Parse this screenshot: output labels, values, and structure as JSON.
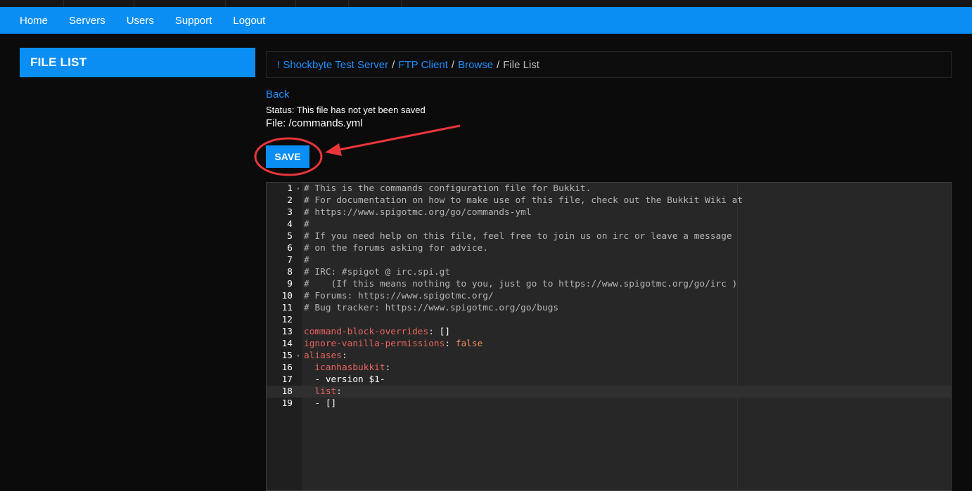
{
  "nav": {
    "items": [
      "Home",
      "Servers",
      "Users",
      "Support",
      "Logout"
    ]
  },
  "sidebar": {
    "title": "FILE LIST"
  },
  "breadcrumb": {
    "items": [
      "! Shockbyte Test Server",
      "FTP Client",
      "Browse"
    ],
    "current": "File List",
    "separator": "/"
  },
  "file_info": {
    "back_label": "Back",
    "status": "Status: This file has not yet been saved",
    "file": "File: /commands.yml"
  },
  "toolbar": {
    "save_label": "SAVE"
  },
  "editor": {
    "active_line": 18,
    "foldable_lines": [
      1,
      15
    ],
    "lines": [
      [
        {
          "t": "comment",
          "v": "# This is the commands configuration file for Bukkit."
        }
      ],
      [
        {
          "t": "comment",
          "v": "# For documentation on how to make use of this file, check out the Bukkit Wiki at"
        }
      ],
      [
        {
          "t": "comment",
          "v": "# https://www.spigotmc.org/go/commands-yml"
        }
      ],
      [
        {
          "t": "comment",
          "v": "#"
        }
      ],
      [
        {
          "t": "comment",
          "v": "# If you need help on this file, feel free to join us on irc or leave a message"
        }
      ],
      [
        {
          "t": "comment",
          "v": "# on the forums asking for advice."
        }
      ],
      [
        {
          "t": "comment",
          "v": "#"
        }
      ],
      [
        {
          "t": "comment",
          "v": "# IRC: #spigot @ irc.spi.gt"
        }
      ],
      [
        {
          "t": "comment",
          "v": "#    (If this means nothing to you, just go to https://www.spigotmc.org/go/irc )"
        }
      ],
      [
        {
          "t": "comment",
          "v": "# Forums: https://www.spigotmc.org/"
        }
      ],
      [
        {
          "t": "comment",
          "v": "# Bug tracker: https://www.spigotmc.org/go/bugs"
        }
      ],
      [],
      [
        {
          "t": "key",
          "v": "command-block-overrides"
        },
        {
          "t": "punct",
          "v": ": "
        },
        {
          "t": "text",
          "v": "[]"
        }
      ],
      [
        {
          "t": "key",
          "v": "ignore-vanilla-permissions"
        },
        {
          "t": "punct",
          "v": ": "
        },
        {
          "t": "bool",
          "v": "false"
        }
      ],
      [
        {
          "t": "key",
          "v": "aliases"
        },
        {
          "t": "punct",
          "v": ":"
        }
      ],
      [
        {
          "t": "text",
          "v": "  "
        },
        {
          "t": "key",
          "v": "icanhasbukkit"
        },
        {
          "t": "punct",
          "v": ":"
        }
      ],
      [
        {
          "t": "text",
          "v": "  - version $1-"
        }
      ],
      [
        {
          "t": "text",
          "v": "  "
        },
        {
          "t": "key",
          "v": "list"
        },
        {
          "t": "punct",
          "v": ":"
        }
      ],
      [
        {
          "t": "text",
          "v": "  - []"
        }
      ]
    ]
  },
  "colors": {
    "accent": "#0a8ef3",
    "link": "#1e90ff",
    "annotation": "#e8363a",
    "editor_bg": "#272727"
  }
}
